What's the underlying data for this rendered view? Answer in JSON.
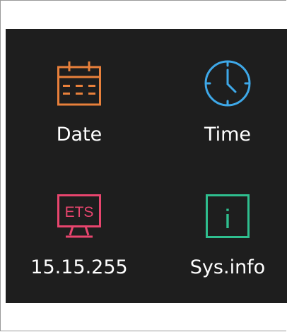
{
  "tiles": [
    {
      "label": "Date",
      "icon": "calendar-icon",
      "color": "#e8803b"
    },
    {
      "label": "Time",
      "icon": "clock-icon",
      "color": "#3ea8e8"
    },
    {
      "label": "15.15.255",
      "icon": "ets-monitor-icon",
      "icon_text": "ETS",
      "color": "#e8456e"
    },
    {
      "label": "Sys.info",
      "icon": "info-icon",
      "icon_text": "i",
      "color": "#2fbf8f"
    }
  ],
  "colors": {
    "screen_background": "#1e1e1e",
    "label_text": "#ffffff"
  }
}
